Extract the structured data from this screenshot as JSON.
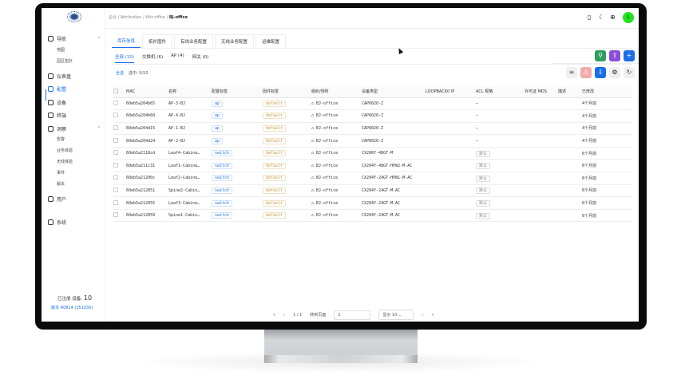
{
  "breadcrumb": [
    "企业",
    "Attribution",
    "Attr-office",
    "BJ-office"
  ],
  "sidebar": {
    "items": [
      {
        "label": "导航",
        "icon": "compass-icon",
        "children": [
          "地图",
          "园区拓扑"
        ]
      },
      {
        "label": "仪表盘",
        "icon": "dashboard-icon"
      },
      {
        "label": "配置",
        "icon": "wrench-icon",
        "active": true
      },
      {
        "label": "设备",
        "icon": "device-icon"
      },
      {
        "label": "终端",
        "icon": "terminal-icon"
      },
      {
        "label": "洞察",
        "icon": "search-icon",
        "children": [
          "告警",
          "业务体验",
          "无线体验",
          "事件",
          "版本"
        ]
      },
      {
        "label": "用户",
        "icon": "users-icon"
      },
      {
        "label": "系统",
        "icon": "gear-icon"
      }
    ],
    "registered_label": "已注册 设备:",
    "registered_count": "10",
    "version": "版本 R0814 (251030)"
  },
  "header": {
    "avatar": "L"
  },
  "tabs": [
    "库存信息",
    "拓扑图件",
    "有线业务配置",
    "无线业务配置",
    "运维配置"
  ],
  "sub_tabs": [
    "全部 (10)",
    "交换机 (6)",
    "AP (4)",
    "网关 (0)"
  ],
  "filter": {
    "all": "全选",
    "selected": "选中: 0/10"
  },
  "colors": {
    "accent": "#1a6fe8",
    "green": "#2e9e5b",
    "purple": "#8a4fd6",
    "avatar": "#1ee31e"
  },
  "columns": [
    "MAC",
    "名称",
    "配置标签",
    "固件标签",
    "组织/场所",
    "设备类型",
    "LOOPBACK0 IP",
    "ACL 规格",
    "许可证 MDS",
    "描述",
    "已修改"
  ],
  "rows": [
    {
      "mac": "60eb5a204b65",
      "name": "AP-3-BJ",
      "cfg": "ap",
      "fw": "default",
      "org": "BJ-office",
      "type": "CAP6020-Z",
      "acl": "–",
      "mod": "4个月前"
    },
    {
      "mac": "60eb5a204b60",
      "name": "AP-4-BJ",
      "cfg": "ap",
      "fw": "default",
      "org": "BJ-office",
      "type": "CAP6020-Z",
      "acl": "–",
      "mod": "4个月前"
    },
    {
      "mac": "60eb5a204d15",
      "name": "AP-1-BJ",
      "cfg": "ap",
      "fw": "default",
      "org": "BJ-office",
      "type": "CAP6020-Z",
      "acl": "–",
      "mod": "4个月前"
    },
    {
      "mac": "60eb5a204d24",
      "name": "AP-2-BJ",
      "cfg": "ap",
      "fw": "default",
      "org": "BJ-office",
      "type": "CAP6020-Z",
      "acl": "–",
      "mod": "4个月前"
    },
    {
      "mac": "60eb5a2118cd",
      "name": "Leaf4-Cabine…",
      "cfg": "switch",
      "fw": "default",
      "org": "BJ-office",
      "type": "CX206Y-48GT-M",
      "acl": "默认",
      "mod": "6个月前"
    },
    {
      "mac": "60eb5a211c31",
      "name": "Leaf1-Cabine…",
      "cfg": "switch",
      "fw": "default",
      "org": "BJ-office",
      "type": "CX204Y-48GT-HPW2-M-AC",
      "acl": "默认",
      "mod": "6个月前"
    },
    {
      "mac": "60eb5a21200c",
      "name": "Leaf2-Cabine…",
      "cfg": "switch",
      "fw": "default",
      "org": "BJ-office",
      "type": "CX204Y-24GT-HPW1-M-AC",
      "acl": "默认",
      "mod": "6个月前"
    },
    {
      "mac": "60eb5a212051",
      "name": "Spine2-Cabin…",
      "cfg": "switch",
      "fw": "default",
      "org": "BJ-office",
      "type": "CX204Y-24GT-M-AC",
      "acl": "默认",
      "mod": "6个月前"
    },
    {
      "mac": "60eb5a212055",
      "name": "Leaf3-Cabine…",
      "cfg": "switch",
      "fw": "default",
      "org": "BJ-office",
      "type": "CX204Y-24GT-M-AC",
      "acl": "默认",
      "mod": "6个月前"
    },
    {
      "mac": "60eb5a212059",
      "name": "Spine1-Cabin…",
      "cfg": "switch",
      "fw": "default",
      "org": "BJ-office",
      "type": "CX204Y-24GT-M-AC",
      "acl": "默认",
      "mod": "6个月前"
    }
  ],
  "pager": {
    "first": "«",
    "prev": "‹",
    "page": "1 / 1",
    "goto_label": "转到页面",
    "goto_value": "1",
    "page_size": "显示 10",
    "next": "›",
    "last": "»"
  }
}
